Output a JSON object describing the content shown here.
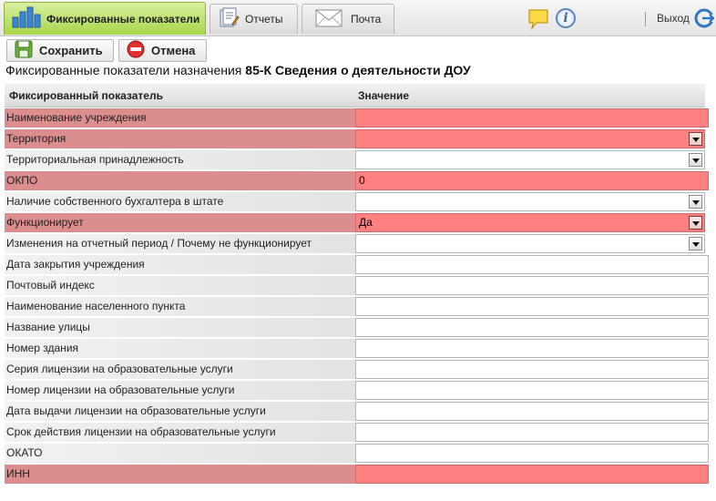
{
  "tabs": [
    {
      "label": "Фиксированные показатели",
      "icon": "bar-chart-icon",
      "active": true
    },
    {
      "label": "Отчеты",
      "icon": "reports-icon",
      "active": false
    },
    {
      "label": "Почта",
      "icon": "mail-envelope-icon",
      "active": false
    }
  ],
  "header": {
    "exit_label": "Выход",
    "tip_icon": "speech-bubble-icon",
    "info_icon": "info-icon",
    "info_glyph": "i",
    "exit_icon": "exit-arrow-icon"
  },
  "toolbar": {
    "save_label": "Сохранить",
    "cancel_label": "Отмена"
  },
  "page": {
    "title_prefix": "Фиксированные показатели назначения",
    "title_bold": "85-К Сведения о деятельности ДОУ"
  },
  "grid": {
    "col_indicator": "Фиксированный показатель",
    "col_value": "Значение",
    "rows": [
      {
        "label": "Наименование учреждения",
        "value": "",
        "type": "text",
        "error": true
      },
      {
        "label": "Территория",
        "value": "",
        "type": "select",
        "error": true
      },
      {
        "label": "Территориальная принадлежность",
        "value": "",
        "type": "select",
        "error": false
      },
      {
        "label": "ОКПО",
        "value": "0",
        "type": "text",
        "error": true
      },
      {
        "label": "Наличие собственного бухгалтера в штате",
        "value": "",
        "type": "select",
        "error": false
      },
      {
        "label": "Функционирует",
        "value": "Да",
        "type": "select",
        "error": true
      },
      {
        "label": "Изменения на отчетный период / Почему не функционирует",
        "value": "",
        "type": "select",
        "error": false
      },
      {
        "label": "Дата закрытия учреждения",
        "value": "",
        "type": "text",
        "error": false
      },
      {
        "label": "Почтовый индекс",
        "value": "",
        "type": "text",
        "error": false
      },
      {
        "label": "Наименование населенного пункта",
        "value": "",
        "type": "text",
        "error": false
      },
      {
        "label": "Название улицы",
        "value": "",
        "type": "text",
        "error": false
      },
      {
        "label": "Номер здания",
        "value": "",
        "type": "text",
        "error": false
      },
      {
        "label": "Серия лицензии на образовательные услуги",
        "value": "",
        "type": "text",
        "error": false
      },
      {
        "label": "Номер лицензии на образовательные услуги",
        "value": "",
        "type": "text",
        "error": false
      },
      {
        "label": "Дата выдачи лицензии на образовательные услуги",
        "value": "",
        "type": "text",
        "error": false
      },
      {
        "label": "Срок действия лицензии на образовательные услуги",
        "value": "",
        "type": "text",
        "error": false
      },
      {
        "label": "ОКАТО",
        "value": "",
        "type": "text",
        "error": false
      },
      {
        "label": "ИНН",
        "value": "",
        "type": "text",
        "error": true
      }
    ]
  },
  "colors": {
    "error_field": "#ff8080",
    "error_label": "#dc8d8d",
    "active_tab": "#a9d54a"
  }
}
